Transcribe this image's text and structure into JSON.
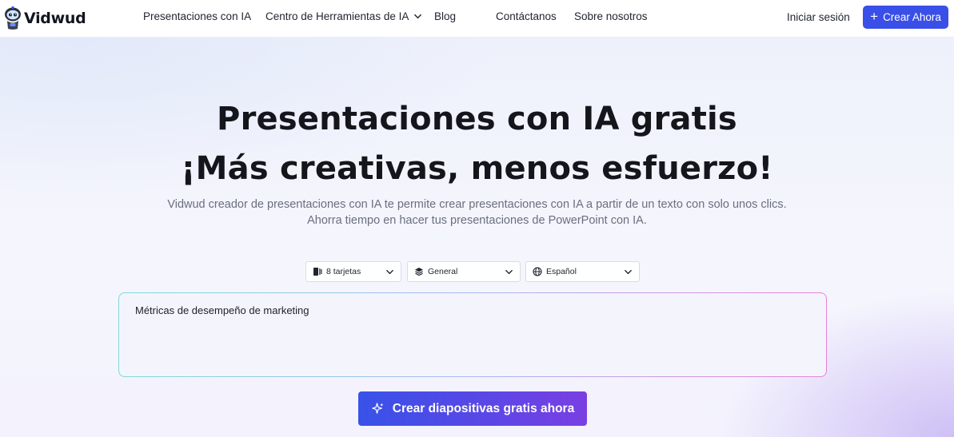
{
  "brand": {
    "name": "Vidwud",
    "accent": "#3a4fe8"
  },
  "nav": {
    "items": [
      {
        "label": "Presentaciones con IA"
      },
      {
        "label": "Centro de Herramientas de IA",
        "icon": "chevron-down-icon"
      },
      {
        "label": "Blog"
      },
      {
        "label": "Contáctanos"
      },
      {
        "label": "Sobre nosotros"
      }
    ],
    "login": "Iniciar sesión",
    "cta": "Crear Ahora"
  },
  "hero": {
    "title_line1": "Presentaciones con IA gratis",
    "title_line2": "¡Más creativas, menos esfuerzo!",
    "subtitle_line1": "Vidwud creador de presentaciones con IA te permite crear presentaciones con IA a partir de un texto con solo unos clics.",
    "subtitle_line2": "Ahorra tiempo en hacer tus presentaciones de PowerPoint con IA."
  },
  "options": {
    "cards": {
      "value": "8 tarjetas",
      "icon": "cards-icon"
    },
    "style": {
      "value": "General",
      "icon": "layers-icon"
    },
    "language": {
      "value": "Español",
      "icon": "globe-icon"
    }
  },
  "prompt": {
    "value": "Métricas de desempeño de marketing"
  },
  "generate_button": {
    "label": "Crear diapositivas gratis ahora",
    "icon": "sparkle-icon"
  }
}
